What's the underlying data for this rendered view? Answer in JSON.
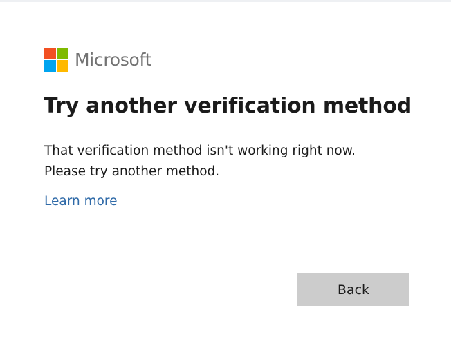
{
  "brand": {
    "name": "Microsoft",
    "logo_colors": {
      "red": "#f25022",
      "green": "#7fba00",
      "blue": "#00a4ef",
      "yellow": "#ffb900"
    }
  },
  "dialog": {
    "title": "Try another verification method",
    "message_lines": [
      "That verification method isn't working right now.",
      "Please try another method."
    ],
    "learn_more_link": "Learn more",
    "back_button": "Back"
  },
  "colors": {
    "link": "#2f6aa8",
    "button_background": "#cccccc",
    "text": "#1b1b1b"
  }
}
